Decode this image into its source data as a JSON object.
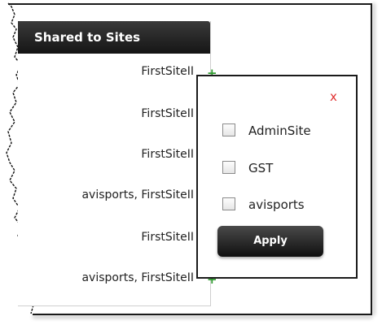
{
  "panel": {
    "header": "Shared to Sites",
    "rows": [
      {
        "sites": "FirstSiteII"
      },
      {
        "sites": "FirstSiteII"
      },
      {
        "sites": "FirstSiteII"
      },
      {
        "sites": "avisports, FirstSiteII"
      },
      {
        "sites": "FirstSiteII"
      },
      {
        "sites": "avisports, FirstSiteII"
      }
    ],
    "add_icon": "+"
  },
  "popup": {
    "close_label": "x",
    "options": [
      {
        "label": "AdminSite",
        "checked": false
      },
      {
        "label": "GST",
        "checked": false
      },
      {
        "label": "avisports",
        "checked": false
      }
    ],
    "apply_label": "Apply"
  },
  "colors": {
    "header_bg": "#1f1f1f",
    "plus": "#2f9a2f",
    "close": "#e03030"
  }
}
